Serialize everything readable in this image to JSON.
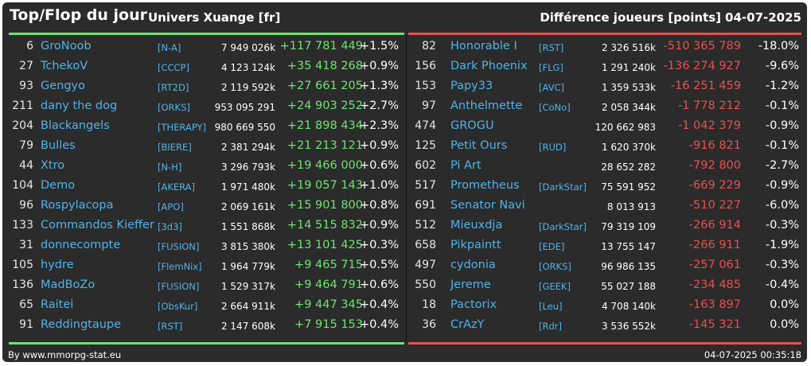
{
  "header": {
    "title": "Top/Flop du jour",
    "universe": "Univers Xuange [fr]",
    "metric": "Différence joueurs [points]",
    "date": "04-07-2025"
  },
  "footer": {
    "source": "By www.mmorpg-stat.eu",
    "timestamp": "04-07-2025 00:35:18"
  },
  "colors": {
    "positive": "#6fe36f",
    "negative": "#e5514e",
    "name": "#4fb3ea",
    "background": "#2b2b2b"
  },
  "top": [
    {
      "rank": "6",
      "name": "GroNoob",
      "tag": "[N-A]",
      "total": "7 949 026k",
      "diff": "+117 781 449",
      "pct": "+1.5%"
    },
    {
      "rank": "27",
      "name": "TchekoV",
      "tag": "[CCCP]",
      "total": "4 123 124k",
      "diff": "+35 418 268",
      "pct": "+0.9%"
    },
    {
      "rank": "93",
      "name": "Gengyo",
      "tag": "[RT2D]",
      "total": "2 119 592k",
      "diff": "+27 661 205",
      "pct": "+1.3%"
    },
    {
      "rank": "211",
      "name": "dany the dog",
      "tag": "[ORKS]",
      "total": "953 095 291",
      "diff": "+24 903 252",
      "pct": "+2.7%"
    },
    {
      "rank": "204",
      "name": "Blackangels",
      "tag": "[THERAPY]",
      "total": "980 669 550",
      "diff": "+21 898 434",
      "pct": "+2.3%"
    },
    {
      "rank": "79",
      "name": "Bulles",
      "tag": "[BIERE]",
      "total": "2 381 294k",
      "diff": "+21 213 121",
      "pct": "+0.9%"
    },
    {
      "rank": "44",
      "name": "Xtro",
      "tag": "[N-H]",
      "total": "3 296 793k",
      "diff": "+19 466 000",
      "pct": "+0.6%"
    },
    {
      "rank": "104",
      "name": "Demo",
      "tag": "[AKERA]",
      "total": "1 971 480k",
      "diff": "+19 057 143",
      "pct": "+1.0%"
    },
    {
      "rank": "96",
      "name": "Rospylacopa",
      "tag": "[APO]",
      "total": "2 069 161k",
      "diff": "+15 901 800",
      "pct": "+0.8%"
    },
    {
      "rank": "133",
      "name": "Commandos Kieffer",
      "tag": "[3d3]",
      "total": "1 551 868k",
      "diff": "+14 515 832",
      "pct": "+0.9%"
    },
    {
      "rank": "31",
      "name": "donnecompte",
      "tag": "[FUSION]",
      "total": "3 815 380k",
      "diff": "+13 101 425",
      "pct": "+0.3%"
    },
    {
      "rank": "105",
      "name": "hydre",
      "tag": "[FlemNix]",
      "total": "1 964 779k",
      "diff": "+9 465 715",
      "pct": "+0.5%"
    },
    {
      "rank": "136",
      "name": "MadBoZo",
      "tag": "[FUSION]",
      "total": "1 529 317k",
      "diff": "+9 464 791",
      "pct": "+0.6%"
    },
    {
      "rank": "65",
      "name": "Raitei",
      "tag": "[ObsKur]",
      "total": "2 664 911k",
      "diff": "+9 447 345",
      "pct": "+0.4%"
    },
    {
      "rank": "91",
      "name": "Reddingtaupe",
      "tag": "[RST]",
      "total": "2 147 608k",
      "diff": "+7 915 153",
      "pct": "+0.4%"
    }
  ],
  "flop": [
    {
      "rank": "82",
      "name": "Honorable I",
      "tag": "[RST]",
      "total": "2 326 516k",
      "diff": "-510 365 789",
      "pct": "-18.0%"
    },
    {
      "rank": "156",
      "name": "Dark Phoenix",
      "tag": "[FLG]",
      "total": "1 291 240k",
      "diff": "-136 274 927",
      "pct": "-9.6%"
    },
    {
      "rank": "153",
      "name": "Papy33",
      "tag": "[AVC]",
      "total": "1 359 533k",
      "diff": "-16 251 459",
      "pct": "-1.2%"
    },
    {
      "rank": "97",
      "name": "Anthelmette",
      "tag": "[CoNo]",
      "total": "2 058 344k",
      "diff": "-1 778 212",
      "pct": "-0.1%"
    },
    {
      "rank": "474",
      "name": "GROGU",
      "tag": "",
      "total": "120 662 983",
      "diff": "-1 042 379",
      "pct": "-0.9%"
    },
    {
      "rank": "125",
      "name": "Petit Ours",
      "tag": "[RUD]",
      "total": "1 620 370k",
      "diff": "-916 821",
      "pct": "-0.1%"
    },
    {
      "rank": "602",
      "name": "Pi Art",
      "tag": "",
      "total": "28 652 282",
      "diff": "-792 800",
      "pct": "-2.7%"
    },
    {
      "rank": "517",
      "name": "Prometheus",
      "tag": "[DarkStar]",
      "total": "75 591 952",
      "diff": "-669 229",
      "pct": "-0.9%"
    },
    {
      "rank": "691",
      "name": "Senator Navi",
      "tag": "",
      "total": "8 013 913",
      "diff": "-510 227",
      "pct": "-6.0%"
    },
    {
      "rank": "512",
      "name": "Mieuxdja",
      "tag": "[DarkStar]",
      "total": "79 319 109",
      "diff": "-266 914",
      "pct": "-0.3%"
    },
    {
      "rank": "658",
      "name": "Pikpaintt",
      "tag": "[EDE]",
      "total": "13 755 147",
      "diff": "-266 911",
      "pct": "-1.9%"
    },
    {
      "rank": "497",
      "name": "cydonia",
      "tag": "[ORKS]",
      "total": "96 986 135",
      "diff": "-257 061",
      "pct": "-0.3%"
    },
    {
      "rank": "550",
      "name": "Jereme",
      "tag": "[GEEK]",
      "total": "55 027 188",
      "diff": "-234 485",
      "pct": "-0.4%"
    },
    {
      "rank": "18",
      "name": "Pactorix",
      "tag": "[Leu]",
      "total": "4 708 140k",
      "diff": "-163 897",
      "pct": "0.0%"
    },
    {
      "rank": "36",
      "name": "CrAzY",
      "tag": "[Rdr]",
      "total": "3 536 552k",
      "diff": "-145 321",
      "pct": "0.0%"
    }
  ]
}
